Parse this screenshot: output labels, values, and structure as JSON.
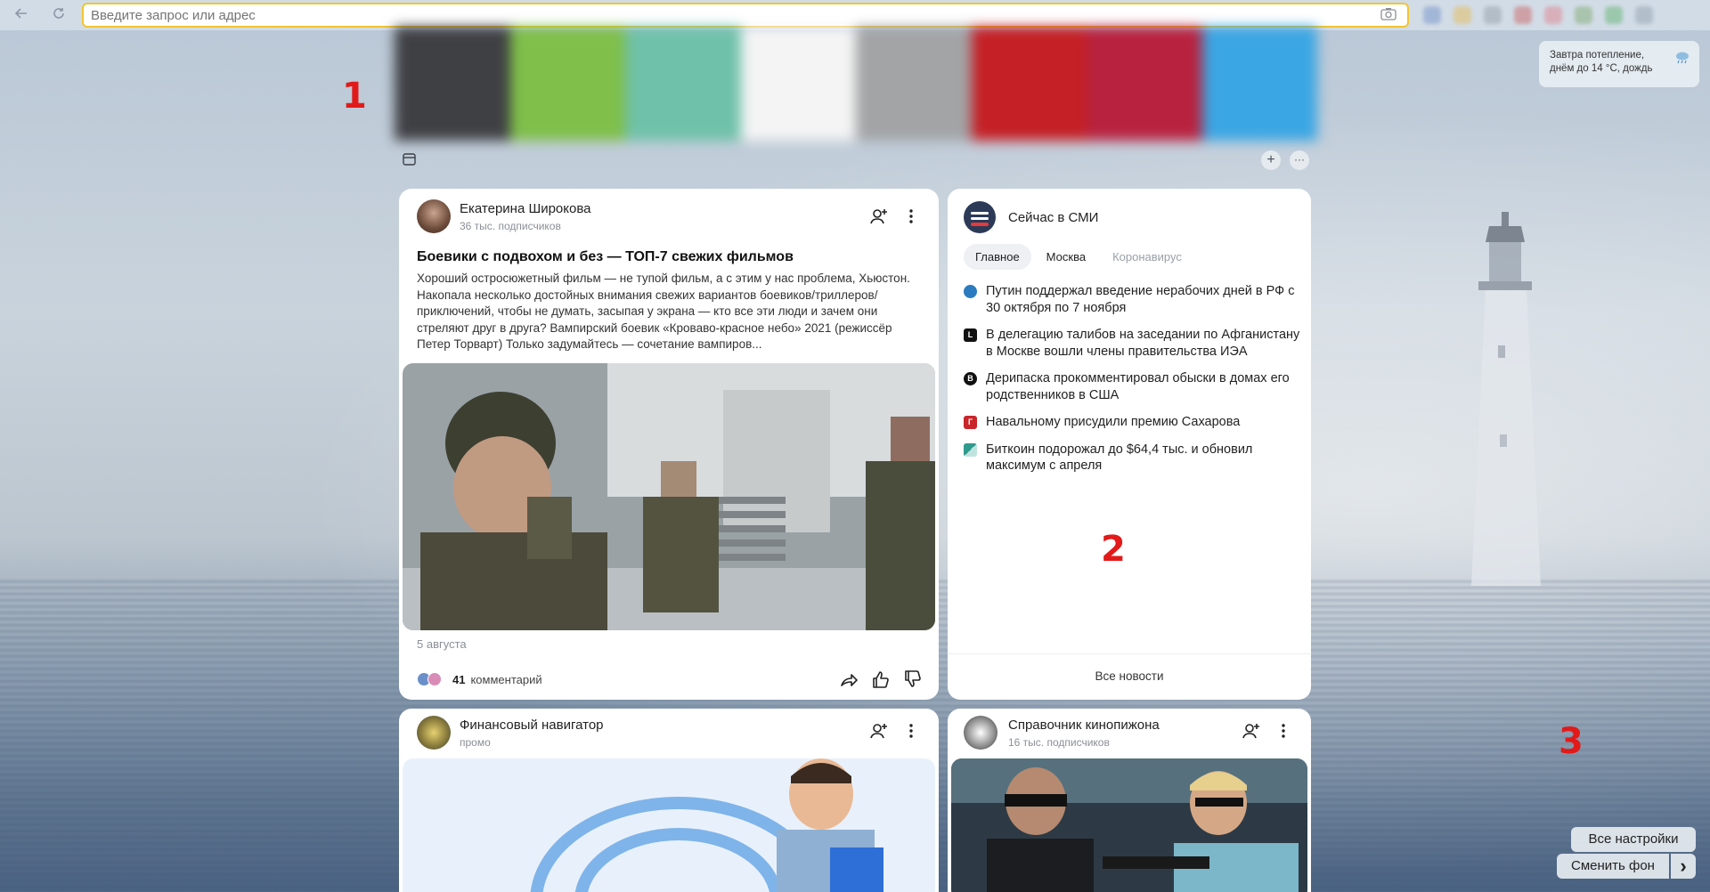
{
  "browser": {
    "address_placeholder": "Введите запрос или адрес",
    "back_icon": "arrow-left-icon",
    "reload_icon": "reload-icon",
    "camera_icon": "camera-search-icon"
  },
  "toolbar": {
    "add_symbol": "+",
    "more_symbol": "···"
  },
  "weather": {
    "text": "Завтра потепление, днём до 14 °C, дождь",
    "icon": "rain-cloud-icon"
  },
  "feed": {
    "post1": {
      "author": "Екатерина Широкова",
      "subscribers": "36 тыс. подписчиков",
      "title": "Боевики с подвохом и без — ТОП-7 свежих фильмов",
      "text": "Хороший остросюжетный фильм — не тупой фильм, а с этим у нас проблема, Хьюстон. Накопала несколько достойных внимания свежих вариантов боевиков/триллеров/приключений, чтобы не думать, засыпая у экрана — кто все эти люди и зачем они стреляют друг в друга? Вампирский боевик «Кроваво-красное небо» 2021 (режиссёр Петер Торварт) Только задумайтесь — сочетание вампиров...",
      "date": "5 августа",
      "comments_count": "41",
      "comments_label": "комментарий"
    },
    "post2": {
      "author": "Финансовый навигатор",
      "subscribers": "промо"
    },
    "post3": {
      "author": "Справочник кинопижона",
      "subscribers": "16 тыс. подписчиков"
    }
  },
  "news": {
    "heading": "Сейчас в СМИ",
    "tabs": [
      {
        "label": "Главное"
      },
      {
        "label": "Москва"
      },
      {
        "label": "Коронавирус"
      }
    ],
    "items": [
      {
        "text": "Путин поддержал введение нерабочих дней в РФ с 30 октября по 7 ноября",
        "src_color": "#2a7bbf",
        "src_letter": ""
      },
      {
        "text": "В делегацию талибов на заседании по Афганистану в Москве вошли члены правительства ИЭА",
        "src_color": "#111111",
        "src_letter": "L"
      },
      {
        "text": "Дерипаска прокомментировал обыски в домах его родственников в США",
        "src_color": "#111111",
        "src_letter": "В"
      },
      {
        "text": "Навальному присудили премию Сахарова",
        "src_color": "#c8262b",
        "src_letter": "Г"
      },
      {
        "text": "Биткоин подорожал до $64,4 тыс. и обновил максимум с апреля",
        "src_color": "#2f9a8e",
        "src_letter": ""
      }
    ],
    "all_news": "Все новости"
  },
  "settings": {
    "all_settings": "Все настройки",
    "change_bg": "Сменить фон",
    "chevron": "›"
  },
  "markers": [
    "1",
    "2",
    "3"
  ]
}
